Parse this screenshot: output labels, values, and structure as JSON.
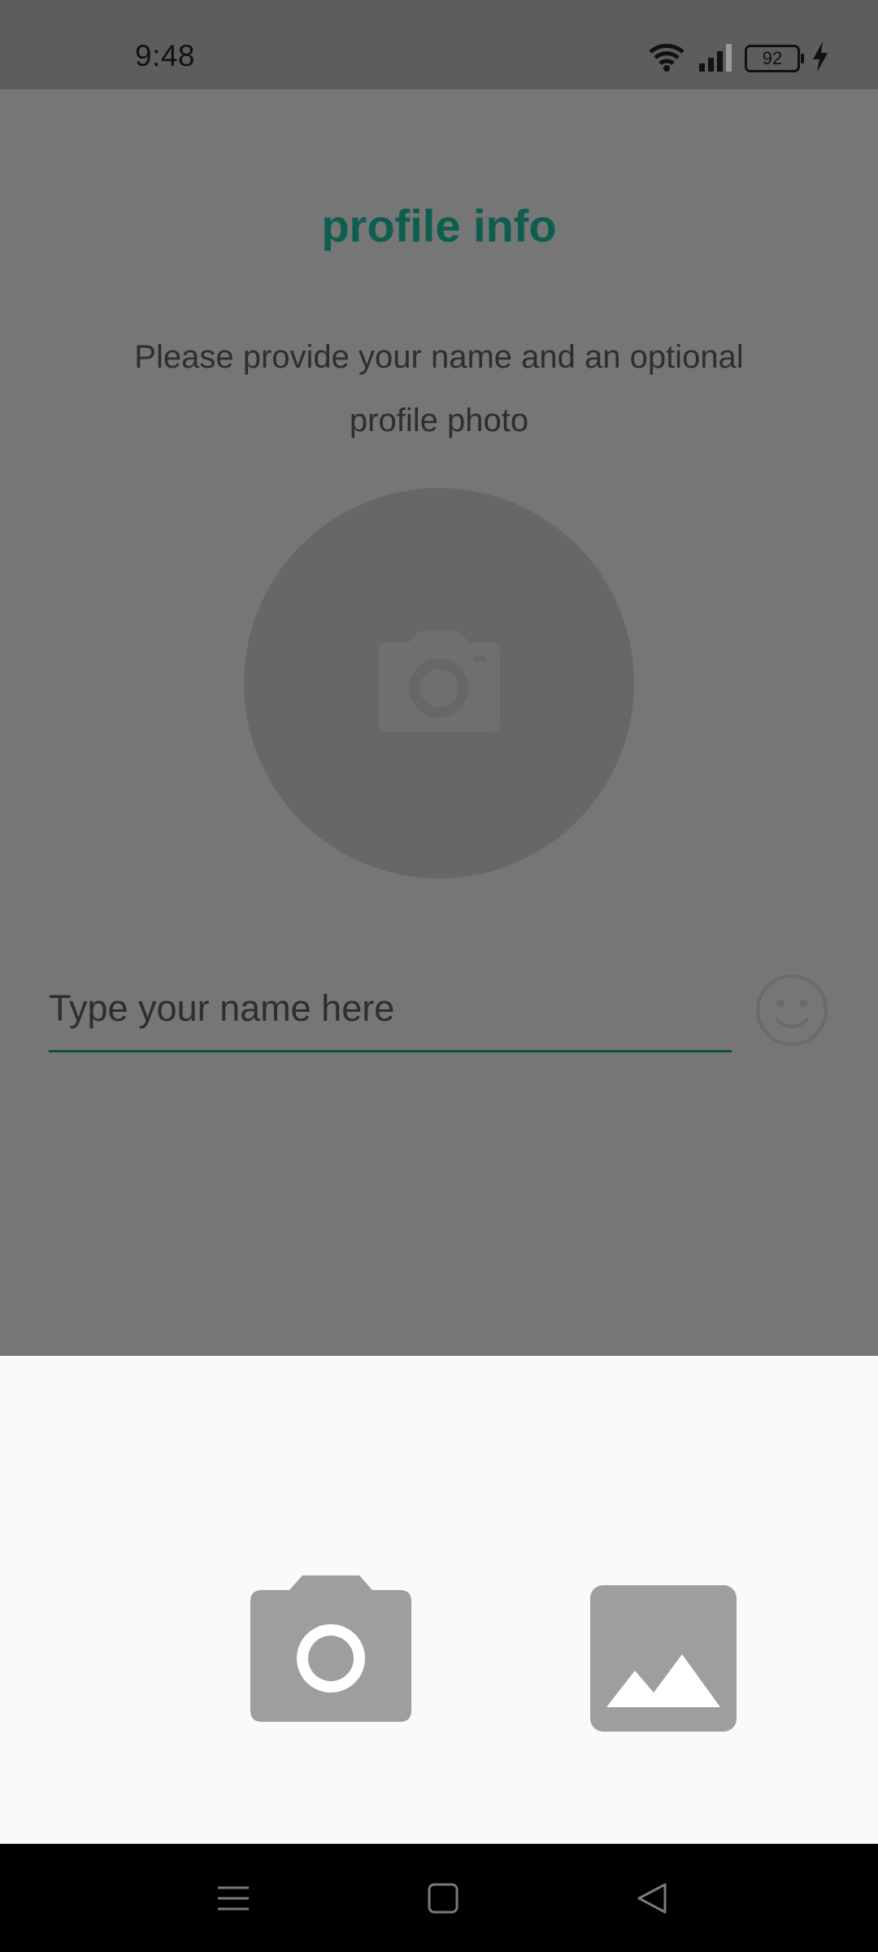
{
  "status_bar": {
    "time": "9:48",
    "battery_level": "92",
    "icons": [
      "wifi-icon",
      "signal-icon",
      "battery-icon",
      "charging-icon"
    ]
  },
  "profile": {
    "title": "profile info",
    "subtitle": "Please provide your name and an optional profile photo",
    "avatar_icon": "camera-icon",
    "name_placeholder": "Type your name here",
    "name_value": "",
    "emoji_icon": "smiley-icon"
  },
  "sheet": {
    "options": [
      {
        "icon": "camera-icon"
      },
      {
        "icon": "gallery-icon"
      }
    ]
  },
  "nav_bar": {
    "icons": [
      "menu-icon",
      "home-icon",
      "back-icon"
    ]
  },
  "colors": {
    "title_accent": "#0d5e4f",
    "underline": "#0f4f43",
    "sheet_icon": "#9e9e9e",
    "overlay": "#767676",
    "sheet_bg": "#fafafa"
  }
}
